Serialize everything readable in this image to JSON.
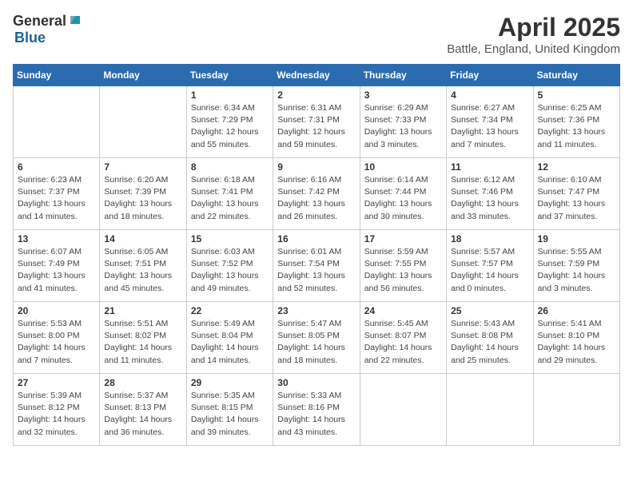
{
  "logo": {
    "general": "General",
    "blue": "Blue"
  },
  "title": "April 2025",
  "subtitle": "Battle, England, United Kingdom",
  "days_of_week": [
    "Sunday",
    "Monday",
    "Tuesday",
    "Wednesday",
    "Thursday",
    "Friday",
    "Saturday"
  ],
  "weeks": [
    [
      {
        "day": "",
        "info": ""
      },
      {
        "day": "",
        "info": ""
      },
      {
        "day": "1",
        "info": "Sunrise: 6:34 AM\nSunset: 7:29 PM\nDaylight: 12 hours\nand 55 minutes."
      },
      {
        "day": "2",
        "info": "Sunrise: 6:31 AM\nSunset: 7:31 PM\nDaylight: 12 hours\nand 59 minutes."
      },
      {
        "day": "3",
        "info": "Sunrise: 6:29 AM\nSunset: 7:33 PM\nDaylight: 13 hours\nand 3 minutes."
      },
      {
        "day": "4",
        "info": "Sunrise: 6:27 AM\nSunset: 7:34 PM\nDaylight: 13 hours\nand 7 minutes."
      },
      {
        "day": "5",
        "info": "Sunrise: 6:25 AM\nSunset: 7:36 PM\nDaylight: 13 hours\nand 11 minutes."
      }
    ],
    [
      {
        "day": "6",
        "info": "Sunrise: 6:23 AM\nSunset: 7:37 PM\nDaylight: 13 hours\nand 14 minutes."
      },
      {
        "day": "7",
        "info": "Sunrise: 6:20 AM\nSunset: 7:39 PM\nDaylight: 13 hours\nand 18 minutes."
      },
      {
        "day": "8",
        "info": "Sunrise: 6:18 AM\nSunset: 7:41 PM\nDaylight: 13 hours\nand 22 minutes."
      },
      {
        "day": "9",
        "info": "Sunrise: 6:16 AM\nSunset: 7:42 PM\nDaylight: 13 hours\nand 26 minutes."
      },
      {
        "day": "10",
        "info": "Sunrise: 6:14 AM\nSunset: 7:44 PM\nDaylight: 13 hours\nand 30 minutes."
      },
      {
        "day": "11",
        "info": "Sunrise: 6:12 AM\nSunset: 7:46 PM\nDaylight: 13 hours\nand 33 minutes."
      },
      {
        "day": "12",
        "info": "Sunrise: 6:10 AM\nSunset: 7:47 PM\nDaylight: 13 hours\nand 37 minutes."
      }
    ],
    [
      {
        "day": "13",
        "info": "Sunrise: 6:07 AM\nSunset: 7:49 PM\nDaylight: 13 hours\nand 41 minutes."
      },
      {
        "day": "14",
        "info": "Sunrise: 6:05 AM\nSunset: 7:51 PM\nDaylight: 13 hours\nand 45 minutes."
      },
      {
        "day": "15",
        "info": "Sunrise: 6:03 AM\nSunset: 7:52 PM\nDaylight: 13 hours\nand 49 minutes."
      },
      {
        "day": "16",
        "info": "Sunrise: 6:01 AM\nSunset: 7:54 PM\nDaylight: 13 hours\nand 52 minutes."
      },
      {
        "day": "17",
        "info": "Sunrise: 5:59 AM\nSunset: 7:55 PM\nDaylight: 13 hours\nand 56 minutes."
      },
      {
        "day": "18",
        "info": "Sunrise: 5:57 AM\nSunset: 7:57 PM\nDaylight: 14 hours\nand 0 minutes."
      },
      {
        "day": "19",
        "info": "Sunrise: 5:55 AM\nSunset: 7:59 PM\nDaylight: 14 hours\nand 3 minutes."
      }
    ],
    [
      {
        "day": "20",
        "info": "Sunrise: 5:53 AM\nSunset: 8:00 PM\nDaylight: 14 hours\nand 7 minutes."
      },
      {
        "day": "21",
        "info": "Sunrise: 5:51 AM\nSunset: 8:02 PM\nDaylight: 14 hours\nand 11 minutes."
      },
      {
        "day": "22",
        "info": "Sunrise: 5:49 AM\nSunset: 8:04 PM\nDaylight: 14 hours\nand 14 minutes."
      },
      {
        "day": "23",
        "info": "Sunrise: 5:47 AM\nSunset: 8:05 PM\nDaylight: 14 hours\nand 18 minutes."
      },
      {
        "day": "24",
        "info": "Sunrise: 5:45 AM\nSunset: 8:07 PM\nDaylight: 14 hours\nand 22 minutes."
      },
      {
        "day": "25",
        "info": "Sunrise: 5:43 AM\nSunset: 8:08 PM\nDaylight: 14 hours\nand 25 minutes."
      },
      {
        "day": "26",
        "info": "Sunrise: 5:41 AM\nSunset: 8:10 PM\nDaylight: 14 hours\nand 29 minutes."
      }
    ],
    [
      {
        "day": "27",
        "info": "Sunrise: 5:39 AM\nSunset: 8:12 PM\nDaylight: 14 hours\nand 32 minutes."
      },
      {
        "day": "28",
        "info": "Sunrise: 5:37 AM\nSunset: 8:13 PM\nDaylight: 14 hours\nand 36 minutes."
      },
      {
        "day": "29",
        "info": "Sunrise: 5:35 AM\nSunset: 8:15 PM\nDaylight: 14 hours\nand 39 minutes."
      },
      {
        "day": "30",
        "info": "Sunrise: 5:33 AM\nSunset: 8:16 PM\nDaylight: 14 hours\nand 43 minutes."
      },
      {
        "day": "",
        "info": ""
      },
      {
        "day": "",
        "info": ""
      },
      {
        "day": "",
        "info": ""
      }
    ]
  ]
}
